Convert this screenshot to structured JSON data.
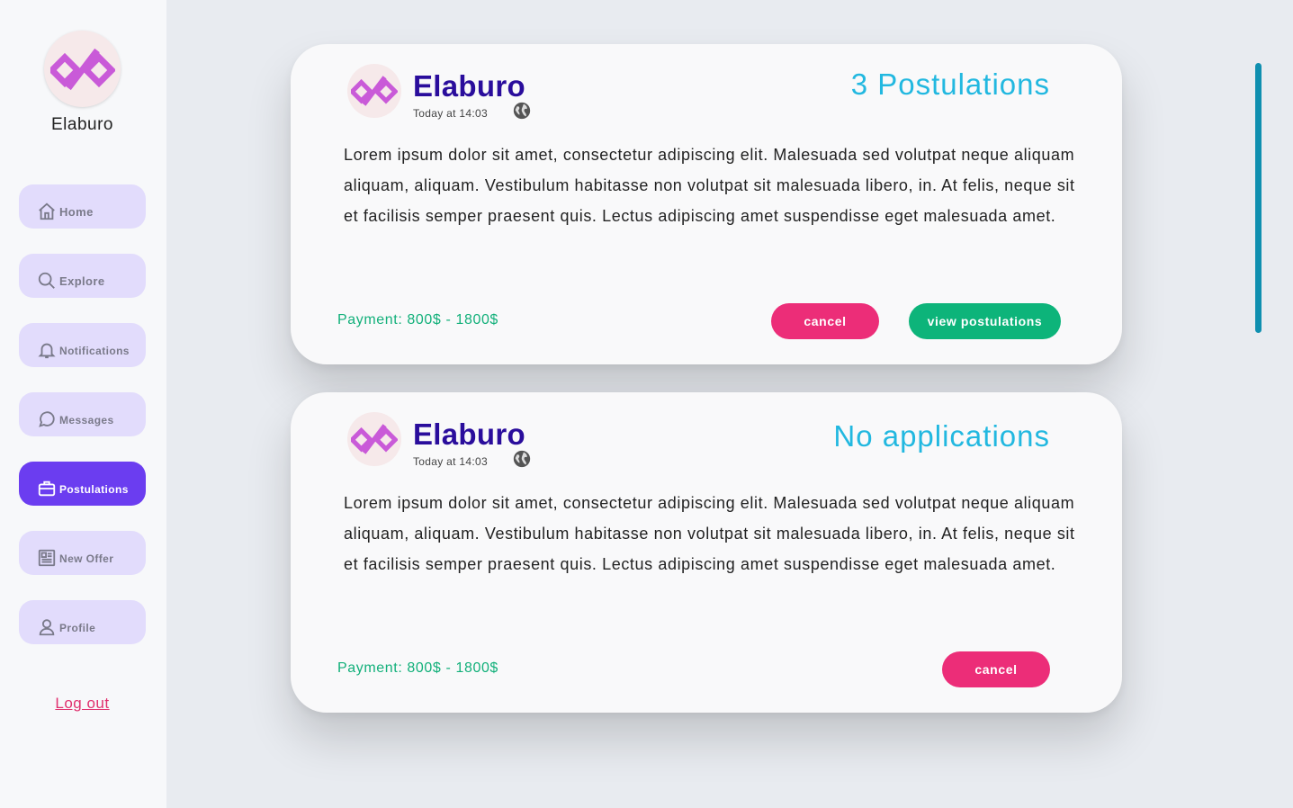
{
  "sidebar": {
    "profile_name": "Elaburo",
    "logout": "Log out",
    "items": [
      {
        "label": "Home",
        "icon": "home-icon"
      },
      {
        "label": "Explore",
        "icon": "search-icon"
      },
      {
        "label": "Notifications",
        "icon": "bell-icon"
      },
      {
        "label": "Messages",
        "icon": "chat-bubble-icon"
      },
      {
        "label": "Postulations",
        "icon": "briefcase-icon",
        "active": true
      },
      {
        "label": "New Offer",
        "icon": "newspaper-icon"
      },
      {
        "label": "Profile",
        "icon": "user-icon"
      }
    ]
  },
  "colors": {
    "accent": "#6b3df0",
    "nav_bg": "#e2dcfc",
    "company": "#2a0d9c",
    "status": "#22b8e0",
    "payment": "#12b07a",
    "cancel": "#ec2d78",
    "view": "#0db47a",
    "logo": "#c95ad8"
  },
  "offers": [
    {
      "company": "Elaburo",
      "time": "Today at 14:03",
      "status": "3 Postulations",
      "description": "Lorem ipsum dolor sit amet, consectetur adipiscing elit. Malesuada sed volutpat neque aliquam aliquam, aliquam. Vestibulum habitasse non volutpat sit malesuada libero, in. At felis, neque sit et facilisis semper praesent quis. Lectus adipiscing amet suspendisse eget malesuada amet.",
      "payment": "Payment: 800$ - 1800$",
      "cancel_label": "cancel",
      "view_label": "view postulations"
    },
    {
      "company": "Elaburo",
      "time": "Today at 14:03",
      "status": "No applications",
      "description": "Lorem ipsum dolor sit amet, consectetur adipiscing elit. Malesuada sed volutpat neque aliquam aliquam, aliquam. Vestibulum habitasse non volutpat sit malesuada libero, in. At felis, neque sit et facilisis semper praesent quis. Lectus adipiscing amet suspendisse eget malesuada amet.",
      "payment": "Payment: 800$ - 1800$",
      "cancel_label": "cancel"
    }
  ]
}
